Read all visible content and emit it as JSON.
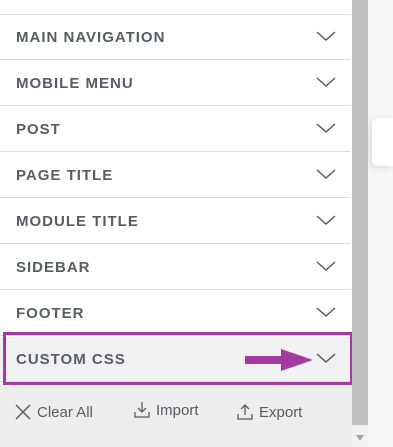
{
  "sections": [
    {
      "label": "MAIN NAVIGATION"
    },
    {
      "label": "MOBILE MENU"
    },
    {
      "label": "POST"
    },
    {
      "label": "PAGE TITLE"
    },
    {
      "label": "MODULE TITLE"
    },
    {
      "label": "SIDEBAR"
    },
    {
      "label": "FOOTER"
    },
    {
      "label": "CUSTOM CSS"
    }
  ],
  "footer": {
    "clear_label": "Clear All",
    "import_label": "Import",
    "export_label": "Export"
  },
  "colors": {
    "highlight": "#a23a9f",
    "text": "#555d66"
  }
}
